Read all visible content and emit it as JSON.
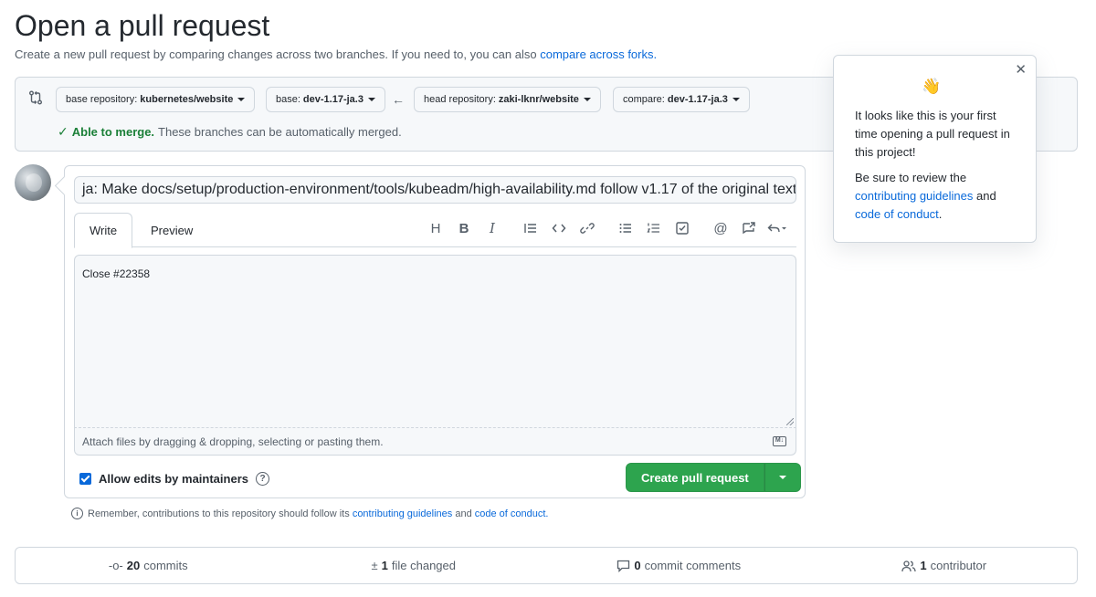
{
  "page": {
    "title": "Open a pull request",
    "subtitle_prefix": "Create a new pull request by comparing changes across two branches. If you need to, you can also",
    "subtitle_link": "compare across forks."
  },
  "compare": {
    "base_repo_label": "base repository:",
    "base_repo_value": "kubernetes/website",
    "base_label": "base:",
    "base_value": "dev-1.17-ja.3",
    "head_repo_label": "head repository:",
    "head_repo_value": "zaki-lknr/website",
    "compare_label": "compare:",
    "compare_value": "dev-1.17-ja.3",
    "merge_ok": "Able to merge.",
    "merge_text": "These branches can be automatically merged."
  },
  "editor": {
    "title_value": "ja: Make docs/setup/production-environment/tools/kubeadm/high-availability.md follow v1.17 of the original text",
    "tabs": [
      {
        "label": "Write"
      },
      {
        "label": "Preview"
      }
    ],
    "body_value": "Close #22358",
    "attach_text": "Attach files by dragging & dropping, selecting or pasting them.",
    "allow_edits_label": "Allow edits by maintainers",
    "create_label": "Create pull request"
  },
  "reminder": {
    "prefix": "Remember, contributions to this repository should follow its",
    "link1": "contributing guidelines",
    "and": "and",
    "link2": "code of conduct."
  },
  "stats": [
    {
      "count": "20",
      "label": "commits"
    },
    {
      "count": "1",
      "label": "file changed"
    },
    {
      "count": "0",
      "label": "commit comments"
    },
    {
      "count": "1",
      "label": "contributor"
    }
  ],
  "popover": {
    "line1": "It looks like this is your first time opening a pull request in this project!",
    "line2_prefix": "Be sure to review the",
    "link1": "contributing guidelines",
    "and": "and",
    "link2": "code of conduct",
    "period": "."
  },
  "colors": {
    "accent_link": "#0969da",
    "success_green": "#2da44e",
    "merge_green": "#1a7f37"
  }
}
